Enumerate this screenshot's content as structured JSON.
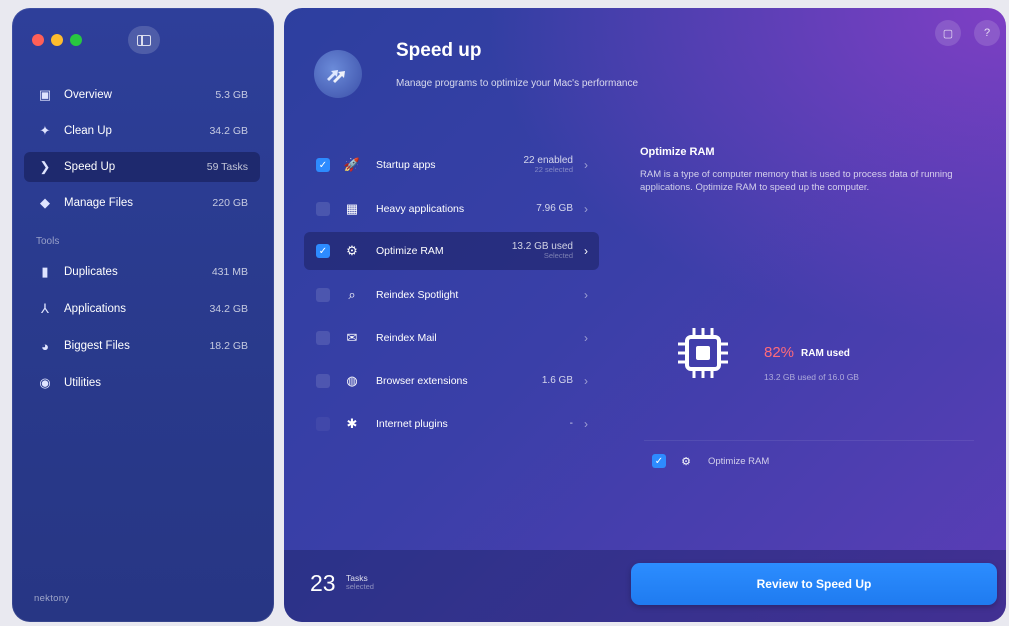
{
  "sidebar": {
    "toggle_icon": "sidebar-toggle-icon",
    "items": [
      {
        "label": "Overview",
        "value": "5.3 GB",
        "icon": "overview-icon"
      },
      {
        "label": "Clean Up",
        "value": "34.2 GB",
        "icon": "broom-icon"
      },
      {
        "label": "Speed Up",
        "value": "59 Tasks",
        "icon": "speed-arrows-icon"
      },
      {
        "label": "Manage Files",
        "value": "220 GB",
        "icon": "files-icon"
      }
    ],
    "tools_label": "Tools",
    "tools": [
      {
        "label": "Duplicates",
        "value": "431 MB",
        "icon": "duplicates-icon"
      },
      {
        "label": "Applications",
        "value": "34.2 GB",
        "icon": "applications-icon"
      },
      {
        "label": "Biggest Files",
        "value": "18.2 GB",
        "icon": "pie-icon"
      },
      {
        "label": "Utilities",
        "value": "",
        "icon": "utilities-icon"
      }
    ],
    "brand": "nektony"
  },
  "header": {
    "title": "Speed up",
    "subtitle": "Manage programs to optimize your Mac's performance"
  },
  "tasks": [
    {
      "label": "Startup apps",
      "value": "22 enabled",
      "sub": "22 selected",
      "checked": true,
      "icon": "rocket-icon"
    },
    {
      "label": "Heavy applications",
      "value": "7.96 GB",
      "sub": "",
      "checked": false,
      "icon": "apps-grid-icon"
    },
    {
      "label": "Optimize RAM",
      "value": "13.2 GB used",
      "sub": "Selected",
      "checked": true,
      "icon": "chip-icon"
    },
    {
      "label": "Reindex Spotlight",
      "value": "",
      "sub": "",
      "checked": false,
      "icon": "search-icon"
    },
    {
      "label": "Reindex Mail",
      "value": "",
      "sub": "",
      "checked": false,
      "icon": "mail-icon"
    },
    {
      "label": "Browser extensions",
      "value": "1.6 GB",
      "sub": "",
      "checked": false,
      "icon": "globe-icon"
    },
    {
      "label": "Internet plugins",
      "value": "-",
      "sub": "",
      "checked": false,
      "icon": "puzzle-icon"
    }
  ],
  "detail": {
    "title": "Optimize RAM",
    "description": "RAM is a type of computer memory that is used to process data of running applications. Optimize RAM to speed up the computer.",
    "ram_percent": "82%",
    "ram_percent_label": "RAM used",
    "ram_sub": "13.2 GB used of 16.0 GB",
    "option_label": "Optimize RAM",
    "option_checked": true
  },
  "footer": {
    "count": "23",
    "count_label": "Tasks",
    "count_sub": "selected",
    "button_label": "Review to Speed Up"
  },
  "colors": {
    "accent": "#2d8bff",
    "ram_percent": "#ff6b7a"
  }
}
